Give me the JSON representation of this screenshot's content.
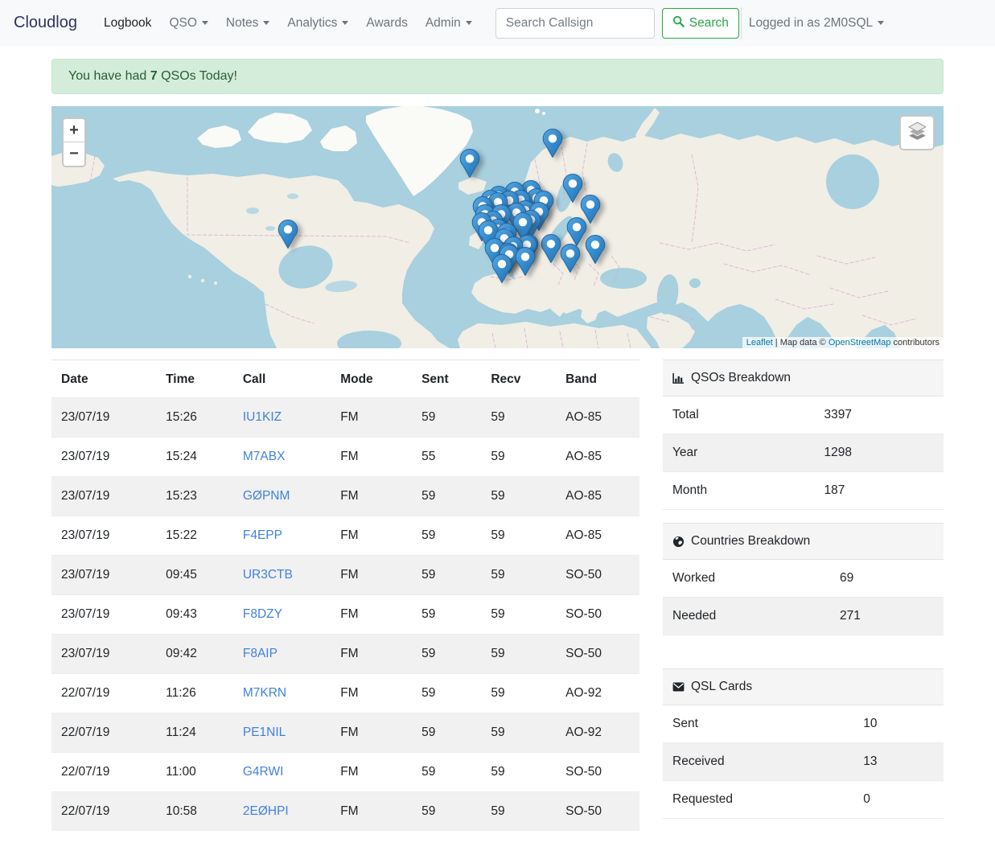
{
  "navbar": {
    "brand": "Cloudlog",
    "items": [
      {
        "label": "Logbook",
        "caret": false,
        "active": true
      },
      {
        "label": "QSO",
        "caret": true,
        "active": false
      },
      {
        "label": "Notes",
        "caret": true,
        "active": false
      },
      {
        "label": "Analytics",
        "caret": true,
        "active": false
      },
      {
        "label": "Awards",
        "caret": false,
        "active": false
      },
      {
        "label": "Admin",
        "caret": true,
        "active": false
      }
    ],
    "search": {
      "placeholder": "Search Callsign",
      "button_label": "Search"
    },
    "user": {
      "label": "Logged in as 2M0SQL"
    }
  },
  "alert": {
    "prefix": "You have had ",
    "count": "7",
    "suffix": " QSOs Today!"
  },
  "map": {
    "zoom_in": "+",
    "zoom_out": "−",
    "attribution": {
      "leaflet": "Leaflet",
      "middle": " | Map data © ",
      "osm": "OpenStreetMap",
      "suffix": " contributors"
    },
    "markers": [
      {
        "x": 26.5,
        "y": 60.5
      },
      {
        "x": 46.9,
        "y": 31.2
      },
      {
        "x": 56.2,
        "y": 22.9
      },
      {
        "x": 58.4,
        "y": 41.5
      },
      {
        "x": 60.4,
        "y": 50.2
      },
      {
        "x": 58.9,
        "y": 59.5
      },
      {
        "x": 61.0,
        "y": 66.8
      },
      {
        "x": 58.2,
        "y": 70.4
      },
      {
        "x": 56.0,
        "y": 66.4
      },
      {
        "x": 53.5,
        "y": 66.4
      },
      {
        "x": 51.3,
        "y": 70.8
      },
      {
        "x": 50.5,
        "y": 74.8
      },
      {
        "x": 53.1,
        "y": 71.8
      },
      {
        "x": 50.1,
        "y": 46.5
      },
      {
        "x": 48.3,
        "y": 50.8
      },
      {
        "x": 50.0,
        "y": 49.2
      },
      {
        "x": 51.3,
        "y": 48.5
      },
      {
        "x": 52.6,
        "y": 48.2
      },
      {
        "x": 54.4,
        "y": 47.5
      },
      {
        "x": 48.6,
        "y": 54.2
      },
      {
        "x": 49.5,
        "y": 56.8
      },
      {
        "x": 50.4,
        "y": 54.2
      },
      {
        "x": 52.1,
        "y": 53.5
      },
      {
        "x": 53.1,
        "y": 52.5
      },
      {
        "x": 48.2,
        "y": 57.5
      },
      {
        "x": 50.0,
        "y": 60.1
      },
      {
        "x": 51.0,
        "y": 61.8
      },
      {
        "x": 52.8,
        "y": 57.5
      },
      {
        "x": 53.7,
        "y": 56.5
      },
      {
        "x": 54.6,
        "y": 53.2
      },
      {
        "x": 49.0,
        "y": 60.8
      },
      {
        "x": 50.8,
        "y": 64.1
      },
      {
        "x": 51.8,
        "y": 67.4
      },
      {
        "x": 53.3,
        "y": 66.8
      },
      {
        "x": 49.7,
        "y": 68.1
      },
      {
        "x": 51.2,
        "y": 70.1
      },
      {
        "x": 49.2,
        "y": 48.2
      },
      {
        "x": 51.9,
        "y": 44.9
      },
      {
        "x": 53.7,
        "y": 44.2
      },
      {
        "x": 55.2,
        "y": 48.5
      }
    ]
  },
  "table": {
    "columns": [
      "Date",
      "Time",
      "Call",
      "Mode",
      "Sent",
      "Recv",
      "Band"
    ],
    "rows": [
      [
        "23/07/19",
        "15:26",
        "IU1KIZ",
        "FM",
        "59",
        "59",
        "AO-85"
      ],
      [
        "23/07/19",
        "15:24",
        "M7ABX",
        "FM",
        "55",
        "59",
        "AO-85"
      ],
      [
        "23/07/19",
        "15:23",
        "GØPNM",
        "FM",
        "59",
        "59",
        "AO-85"
      ],
      [
        "23/07/19",
        "15:22",
        "F4EPP",
        "FM",
        "59",
        "59",
        "AO-85"
      ],
      [
        "23/07/19",
        "09:45",
        "UR3CTB",
        "FM",
        "59",
        "59",
        "SO-50"
      ],
      [
        "23/07/19",
        "09:43",
        "F8DZY",
        "FM",
        "59",
        "59",
        "SO-50"
      ],
      [
        "23/07/19",
        "09:42",
        "F8AIP",
        "FM",
        "59",
        "59",
        "SO-50"
      ],
      [
        "22/07/19",
        "11:26",
        "M7KRN",
        "FM",
        "59",
        "59",
        "AO-92"
      ],
      [
        "22/07/19",
        "11:24",
        "PE1NIL",
        "FM",
        "59",
        "59",
        "AO-92"
      ],
      [
        "22/07/19",
        "11:00",
        "G4RWI",
        "FM",
        "59",
        "59",
        "SO-50"
      ],
      [
        "22/07/19",
        "10:58",
        "2EØHPI",
        "FM",
        "59",
        "59",
        "SO-50"
      ]
    ]
  },
  "sidebar": {
    "cards": [
      {
        "icon": "bar-chart-icon",
        "title": "QSOs Breakdown",
        "rows": [
          [
            "Total",
            "3397"
          ],
          [
            "Year",
            "1298"
          ],
          [
            "Month",
            "187"
          ]
        ]
      },
      {
        "icon": "globe-icon",
        "title": "Countries Breakdown",
        "rows": [
          [
            "Worked",
            "69"
          ],
          [
            "Needed",
            "271"
          ]
        ]
      },
      {
        "icon": "envelope-icon",
        "title": "QSL Cards",
        "rows": [
          [
            "Sent",
            "10"
          ],
          [
            "Received",
            "13"
          ],
          [
            "Requested",
            "0"
          ]
        ]
      }
    ]
  },
  "colors": {
    "accent_green": "#28a745",
    "alert_bg": "#d4edda",
    "link_blue": "#4181e0",
    "marker_blue": "#3389cb",
    "map_water": "#a8d0de",
    "map_land": "#f1eee6"
  }
}
